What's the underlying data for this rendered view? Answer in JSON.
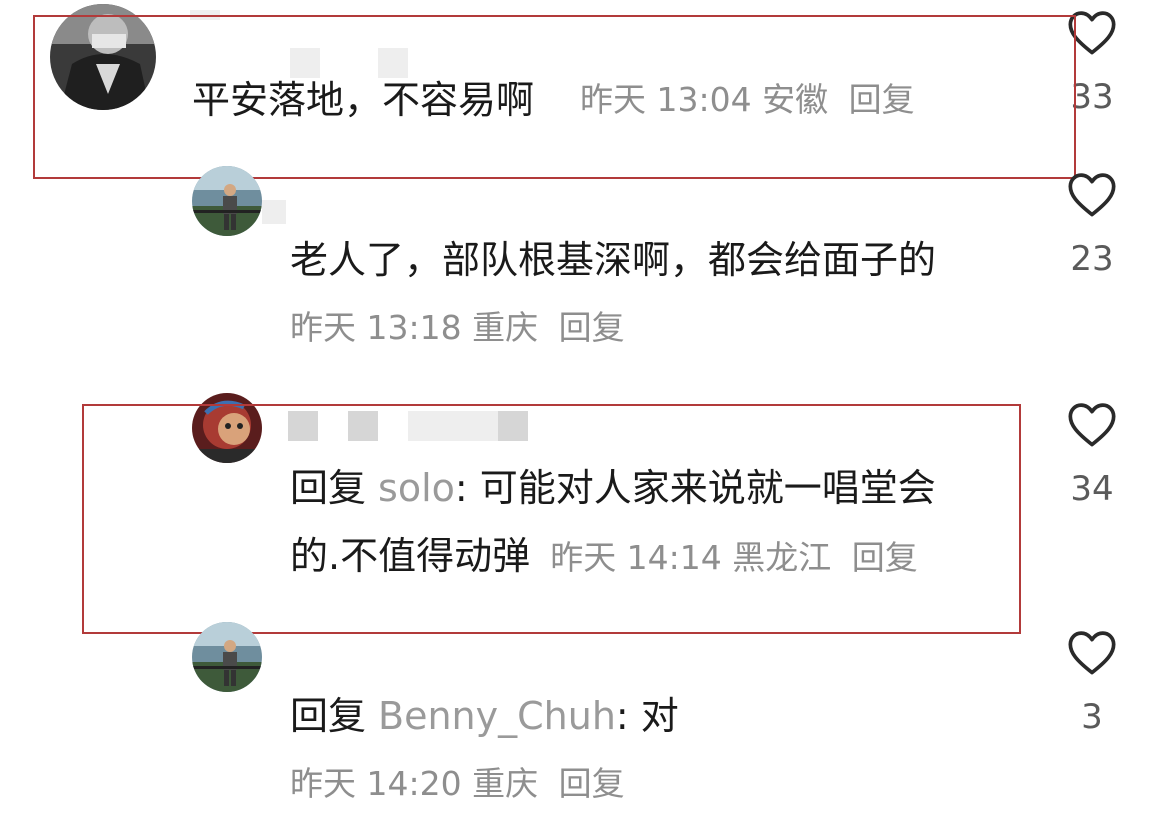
{
  "comments": [
    {
      "text": "平安落地，不容易啊",
      "meta": "昨天 13:04 安徽",
      "reply_label": "回复",
      "likes": "33"
    },
    {
      "text": "老人了，部队根基深啊，都会给面子的",
      "meta": "昨天 13:18 重庆",
      "reply_label": "回复",
      "likes": "23"
    },
    {
      "reply_prefix": "回复",
      "reply_to": "solo",
      "text_line1": ": 可能对人家来说就一唱堂会",
      "text_line2": "的.不值得动弹",
      "meta": "昨天 14:14 黑龙江",
      "reply_label": "回复",
      "likes": "34"
    },
    {
      "reply_prefix": "回复",
      "reply_to": "Benny_Chuh",
      "text": ": 对",
      "meta": "昨天 14:20 重庆",
      "reply_label": "回复",
      "likes": "3"
    }
  ],
  "icons": {
    "like": "heart-outline-icon"
  },
  "colors": {
    "highlight_border": "#b23a3a",
    "meta_text": "#8e8e8e",
    "body_text": "#1a1a1a"
  }
}
